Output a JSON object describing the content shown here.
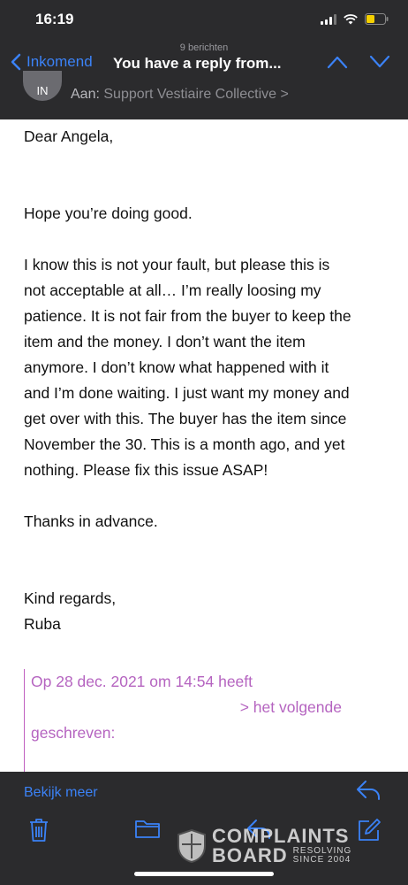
{
  "status": {
    "time": "16:19"
  },
  "header": {
    "message_count": "9 berichten",
    "back_label": "Inkomend",
    "subject": "You have a reply from...",
    "avatar_initials": "IN",
    "to_label": "Aan:",
    "to_name": "Support Vestiaire Collective >"
  },
  "body": {
    "greeting": "Dear Angela,",
    "para1": "Hope you’re doing good.",
    "para2_lines": [
      "I know this is not your fault, but please this is",
      "not acceptable at all… I’m really loosing my",
      "patience. It is not fair from the buyer to keep the",
      "item and the money. I don’t want the item",
      "anymore. I don’t know what happened with it",
      "and I’m done waiting. I just want my money and",
      "get over with this. The buyer has the item since",
      "November the 30. This is a month ago, and yet",
      "nothing. Please fix this issue ASAP!"
    ],
    "thanks": "Thanks in advance.",
    "closing": "Kind regards,",
    "signature": "Ruba"
  },
  "quote": {
    "line1": "Op 28 dec. 2021 om 14:54 heeft",
    "line2": "> het volgende",
    "line3": "geschreven:"
  },
  "toolbar": {
    "show_more": "Bekijk meer",
    "icons": [
      "reply-icon",
      "trash-icon",
      "folder-icon",
      "reply-icon",
      "compose-icon"
    ]
  },
  "watermark": {
    "line1": "COMPLAINTS",
    "line2": "BOARD",
    "tag1": "RESOLVING",
    "tag2": "SINCE 2004"
  },
  "colors": {
    "accent": "#3b82f6",
    "quote": "#b564c0",
    "bar": "#2b2b2d"
  }
}
